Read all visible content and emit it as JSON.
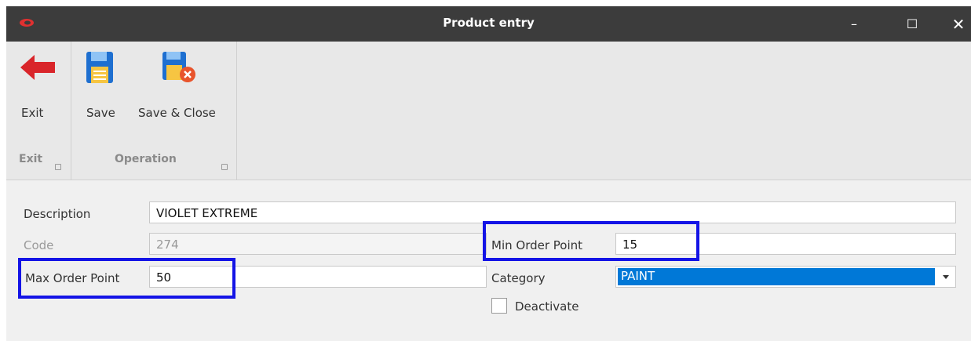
{
  "window": {
    "title": "Product entry",
    "controls": {
      "minimize": "–",
      "maximize": "☐",
      "close": "✕"
    }
  },
  "ribbon": {
    "groups": [
      {
        "label": "Exit",
        "buttons": [
          {
            "label": "Exit",
            "icon": "back-arrow-icon"
          }
        ]
      },
      {
        "label": "Operation",
        "buttons": [
          {
            "label": "Save",
            "icon": "save-icon"
          },
          {
            "label": "Save & Close",
            "icon": "save-close-icon"
          }
        ]
      }
    ]
  },
  "form": {
    "description": {
      "label": "Description",
      "value": "VIOLET EXTREME"
    },
    "code": {
      "label": "Code",
      "value": "274"
    },
    "min_order_point": {
      "label": "Min Order Point",
      "value": "15"
    },
    "max_order_point": {
      "label": "Max Order Point",
      "value": "50"
    },
    "category": {
      "label": "Category",
      "value": "PAINT"
    },
    "deactivate": {
      "label": "Deactivate",
      "checked": false
    }
  },
  "colors": {
    "titlebar": "#3c3c3c",
    "accent": "#0078d7",
    "highlight": "#1414e6",
    "exit_arrow": "#d9252a"
  }
}
